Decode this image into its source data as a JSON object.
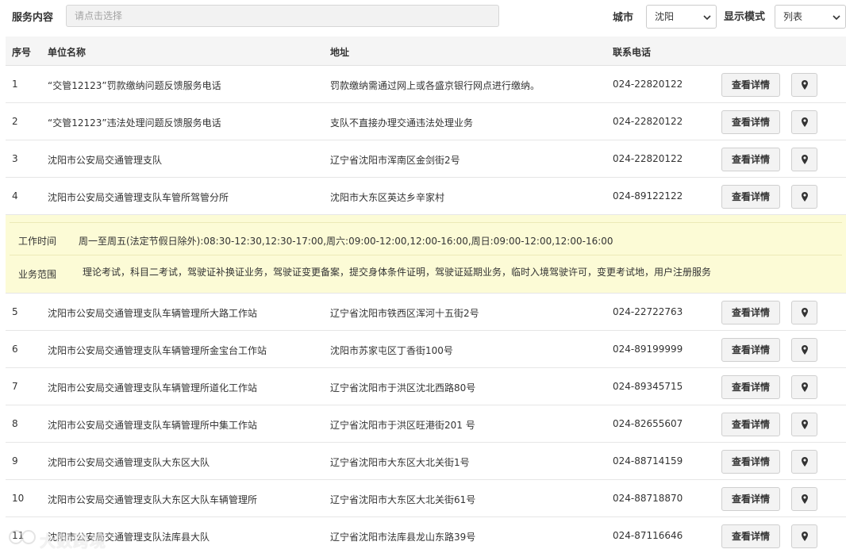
{
  "filters": {
    "service_label": "服务内容",
    "service_placeholder": "请点击选择",
    "city_label": "城市",
    "city_value": "沈阳",
    "mode_label": "显示模式",
    "mode_value": "列表"
  },
  "table": {
    "headers": {
      "no": "序号",
      "name": "单位名称",
      "address": "地址",
      "phone": "联系电话"
    },
    "detail_button_label": "查看详情",
    "rows_top": [
      {
        "no": "1",
        "name": "“交管12123”罚款缴纳问题反馈服务电话",
        "address": "罚款缴纳需通过网上或各盛京银行网点进行缴纳。",
        "phone": "024-22820122"
      },
      {
        "no": "2",
        "name": "“交管12123”违法处理问题反馈服务电话",
        "address": "支队不直接办理交通违法处理业务",
        "phone": "024-22820122"
      },
      {
        "no": "3",
        "name": "沈阳市公安局交通管理支队",
        "address": "辽宁省沈阳市浑南区金剑街2号",
        "phone": "024-22820122"
      },
      {
        "no": "4",
        "name": "沈阳市公安局交通管理支队车管所驾管分所",
        "address": "沈阳市大东区英达乡辛家村",
        "phone": "024-89122122"
      }
    ],
    "detail": {
      "hours_label": "工作时间",
      "hours_value": "周一至周五(法定节假日除外):08:30-12:30,12:30-17:00,周六:09:00-12:00,12:00-16:00,周日:09:00-12:00,12:00-16:00",
      "scope_label": "业务范围",
      "scope_value": "理论考试，科目二考试，驾驶证补换证业务，驾驶证变更备案，提交身体条件证明，驾驶证延期业务，临时入境驾驶许可，变更考试地，用户注册服务"
    },
    "rows_bottom": [
      {
        "no": "5",
        "name": "沈阳市公安局交通管理支队车辆管理所大路工作站",
        "address": "辽宁省沈阳市铁西区浑河十五街2号",
        "phone": "024-22722763"
      },
      {
        "no": "6",
        "name": "沈阳市公安局交通管理支队车辆管理所金宝台工作站",
        "address": "沈阳市苏家屯区丁香街100号",
        "phone": "024-89199999"
      },
      {
        "no": "7",
        "name": "沈阳市公安局交通管理支队车辆管理所道化工作站",
        "address": "辽宁省沈阳市于洪区沈北西路80号",
        "phone": "024-89345715"
      },
      {
        "no": "8",
        "name": "沈阳市公安局交通管理支队车辆管理所中集工作站",
        "address": "辽宁省沈阳市于洪区旺港街201 号",
        "phone": "024-82655607"
      },
      {
        "no": "9",
        "name": "沈阳市公安局交通管理支队大东区大队",
        "address": "辽宁省沈阳市大东区大北关街1号",
        "phone": "024-88714159"
      },
      {
        "no": "10",
        "name": "沈阳市公安局交通管理支队大东区大队车辆管理所",
        "address": "辽宁省沈阳市大东区大北关街61号",
        "phone": "024-88718870"
      },
      {
        "no": "11",
        "name": "沈阳市公安局交通管理支队法库县大队",
        "address": "辽宁省沈阳市法库县龙山东路39号",
        "phone": "024-87116646"
      }
    ]
  },
  "watermark": {
    "text": "大数跨境"
  }
}
